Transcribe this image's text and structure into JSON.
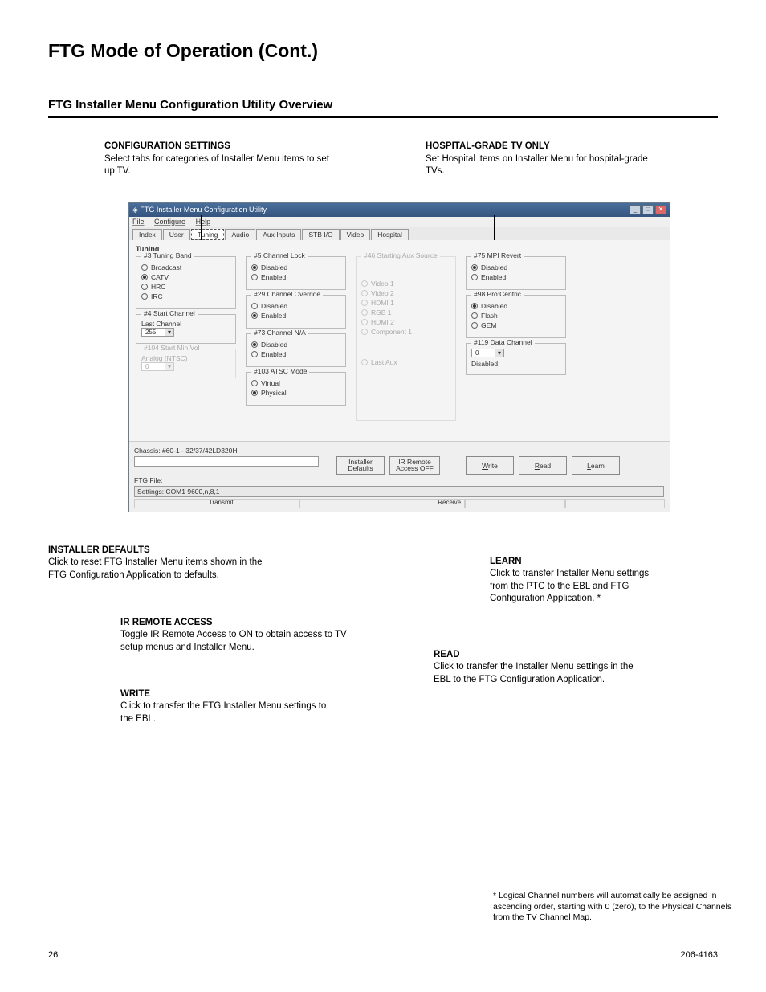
{
  "page_title": "FTG Mode of Operation (Cont.)",
  "section_title": "FTG Installer Menu Configuration Utility Overview",
  "callout_top_left_head": "CONFIGURATION SETTINGS",
  "callout_top_left_body": "Select tabs for categories of Installer Menu items to set up TV.",
  "callout_top_right_head": "HOSPITAL-GRADE TV ONLY",
  "callout_top_right_body": "Set Hospital items on Installer Menu for hospital-grade TVs.",
  "window": {
    "title": "FTG Installer Menu Configuration Utility",
    "menus": {
      "file": "File",
      "configure": "Configure",
      "help": "Help"
    },
    "tabs": [
      "Index",
      "User",
      "Tuning",
      "Audio",
      "Aux Inputs",
      "STB I/O",
      "Video",
      "Hospital"
    ],
    "active_tab": "Tuning",
    "tab_heading": "Tuning",
    "groups": {
      "tuning_band": {
        "legend": "#3 Tuning Band",
        "opts": [
          "Broadcast",
          "CATV",
          "HRC",
          "IRC"
        ],
        "sel": "CATV"
      },
      "start_channel": {
        "legend": "#4 Start Channel",
        "label": "Last Channel",
        "value": "255"
      },
      "start_minor": {
        "legend": "#104 Start Min Vol",
        "label": "Analog (NTSC)",
        "value": "0"
      },
      "channel_lock": {
        "legend": "#5 Channel Lock",
        "opts": [
          "Disabled",
          "Enabled"
        ],
        "sel": "Disabled"
      },
      "channel_override": {
        "legend": "#29 Channel Override",
        "opts": [
          "Disabled",
          "Enabled"
        ],
        "sel": "Enabled"
      },
      "channel_na": {
        "legend": "#73 Channel N/A",
        "opts": [
          "Disabled",
          "Enabled"
        ],
        "sel": "Disabled"
      },
      "atsc_mode": {
        "legend": "#103 ATSC Mode",
        "opts": [
          "Virtual",
          "Physical"
        ],
        "sel": "Physical"
      },
      "starting_aux": {
        "legend": "#46 Starting Aux Source",
        "opts": [
          "Video 1",
          "Video 2",
          "HDMI 1",
          "RGB 1",
          "HDMI 2",
          "Component 1",
          "",
          "Last Aux"
        ]
      },
      "mpi_revert": {
        "legend": "#75 MPI Revert",
        "opts": [
          "Disabled",
          "Enabled"
        ],
        "sel": "Disabled"
      },
      "pro_centric": {
        "legend": "#98 Pro:Centric",
        "opts": [
          "Disabled",
          "Flash",
          "GEM"
        ],
        "sel": "Disabled"
      },
      "data_channel": {
        "legend": "#119 Data Channel",
        "value": "0",
        "note": "Disabled"
      }
    },
    "chassis_label": "Chassis:  #60-1 - 32/37/42LD320H",
    "ftg_file_label": "FTG File:",
    "settings_line": "Settings: COM1 9600,n,8,1",
    "buttons": {
      "installer_defaults_l1": "Installer",
      "installer_defaults_l2": "Defaults",
      "ir_l1": "IR Remote",
      "ir_l2": "Access OFF",
      "write": "Write",
      "read": "Read",
      "learn": "Learn"
    },
    "transmit": "Transmit",
    "receive": "Receive"
  },
  "cb_defaults_head": "INSTALLER DEFAULTS",
  "cb_defaults_body": "Click to reset FTG Installer Menu items shown in the FTG Configuration Application to defaults.",
  "cb_ir_head": "IR REMOTE ACCESS",
  "cb_ir_body": "Toggle IR Remote Access to ON to obtain access to TV setup menus and Installer Menu.",
  "cb_write_head": "WRITE",
  "cb_write_body": "Click to transfer the FTG Installer Menu settings to the EBL.",
  "cb_read_head": "READ",
  "cb_read_body": "Click to transfer the Installer Menu settings in the EBL to the FTG Configuration Application.",
  "cb_learn_head": "LEARN",
  "cb_learn_body": "Click to transfer Installer Menu settings from the PTC to the EBL and FTG Configuration Application. *",
  "footnote": "* Logical Channel numbers will automatically be assigned in ascending order, starting with 0 (zero), to the Physical Channels from the TV Channel Map.",
  "page_number": "26",
  "doc_number": "206-4163"
}
